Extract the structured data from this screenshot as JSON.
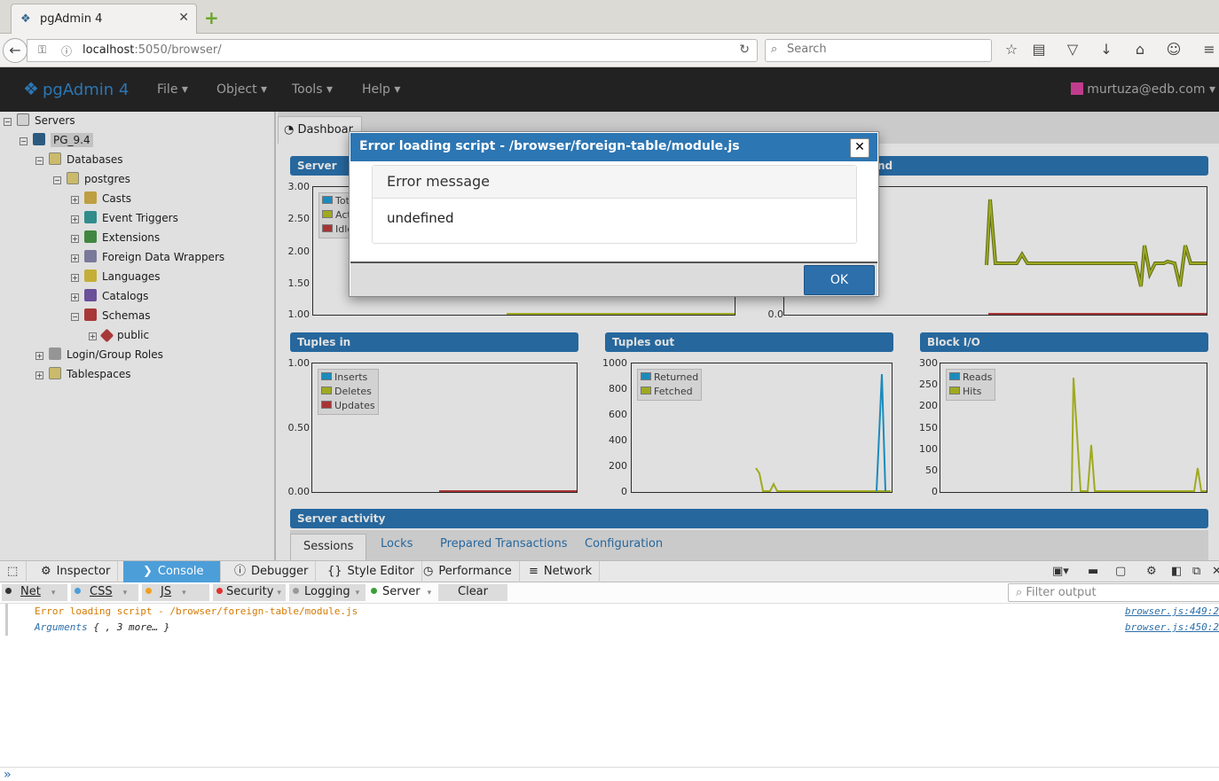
{
  "browser": {
    "tab_title": "pgAdmin 4",
    "url_host": "localhost",
    "url_rest": ":5050/browser/",
    "search_placeholder": "Search"
  },
  "app": {
    "brand": "pgAdmin 4",
    "menus": [
      "File",
      "Object",
      "Tools",
      "Help"
    ],
    "user": "murtuza@edb.com"
  },
  "tree": [
    {
      "label": "Servers"
    },
    {
      "label": "PG_9.4"
    },
    {
      "label": "Databases"
    },
    {
      "label": "postgres"
    },
    {
      "label": "Casts"
    },
    {
      "label": "Event Triggers"
    },
    {
      "label": "Extensions"
    },
    {
      "label": "Foreign Data Wrappers"
    },
    {
      "label": "Languages"
    },
    {
      "label": "Catalogs"
    },
    {
      "label": "Schemas"
    },
    {
      "label": "public"
    },
    {
      "label": "Login/Group Roles"
    },
    {
      "label": "Tablespaces"
    }
  ],
  "dashboard": {
    "tab": "Dashboar",
    "server_sessions": {
      "title": "Server se",
      "ticks": [
        "3.00",
        "2.50",
        "2.00",
        "1.50",
        "1.00"
      ],
      "legend": [
        "Tot",
        "Act",
        "Idle"
      ]
    },
    "tps": {
      "title": "nd",
      "ticks": [
        "0.0"
      ]
    },
    "tuples_in": {
      "title": "Tuples in",
      "ticks": [
        "1.00",
        "0.50",
        "0.00"
      ],
      "legend": [
        "Inserts",
        "Deletes",
        "Updates"
      ]
    },
    "tuples_out": {
      "title": "Tuples out",
      "ticks": [
        "1000",
        "800",
        "600",
        "400",
        "200",
        "0"
      ],
      "legend": [
        "Returned",
        "Fetched"
      ]
    },
    "block_io": {
      "title": "Block I/O",
      "ticks": [
        "300",
        "250",
        "200",
        "150",
        "100",
        "50",
        "0"
      ],
      "legend": [
        "Reads",
        "Hits"
      ]
    },
    "server_activity": {
      "title": "Server activity",
      "tabs": [
        "Sessions",
        "Locks",
        "Prepared Transactions",
        "Configuration"
      ]
    },
    "colors": {
      "blue": "#1e9fd6",
      "olive": "#b5c224",
      "red": "#c03c3c"
    }
  },
  "dialog": {
    "title": "Error loading script - /browser/foreign-table/module.js",
    "box_title": "Error message",
    "message": "undefined",
    "ok": "OK"
  },
  "devtools": {
    "tabs": [
      "Inspector",
      "Console",
      "Debugger",
      "Style Editor",
      "Performance",
      "Network"
    ],
    "filters": [
      "Net",
      "CSS",
      "JS",
      "Security",
      "Logging",
      "Server",
      "Clear"
    ],
    "filter_placeholder": "Filter output",
    "logs": [
      {
        "msg": "Error loading script - /browser/foreign-table/module.js",
        "src": "browser.js:449:2"
      },
      {
        "msg_a": "Arguments",
        "msg_b": " { , 3 more… }",
        "src": "browser.js:450:2"
      }
    ]
  }
}
